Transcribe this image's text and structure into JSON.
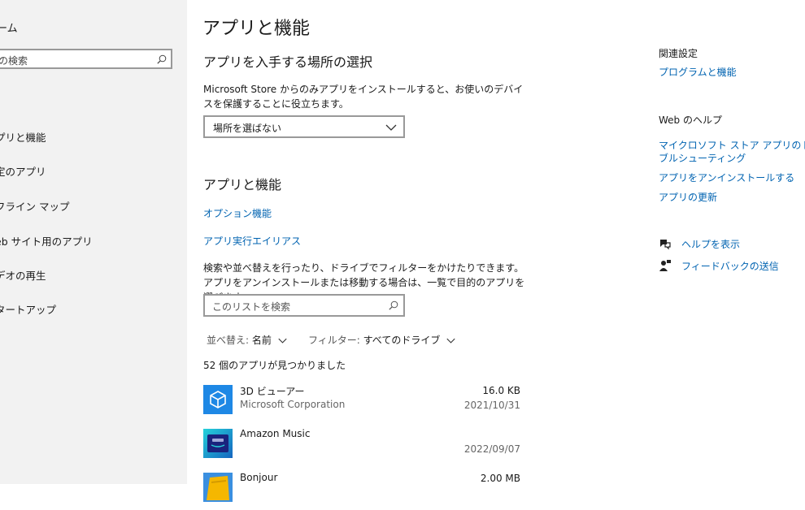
{
  "sidebar": {
    "home_label": "ーム",
    "search_placeholder": "の検索",
    "items": [
      {
        "label": "プリと機能"
      },
      {
        "label": "定のアプリ"
      },
      {
        "label": "フライン マップ"
      },
      {
        "label": "eb サイト用のアプリ"
      },
      {
        "label": "デオの再生"
      },
      {
        "label": "タートアップ"
      }
    ]
  },
  "main": {
    "title": "アプリと機能",
    "choose_section": {
      "title": "アプリを入手する場所の選択",
      "description": "Microsoft Store からのみアプリをインストールすると、お使いのデバイスを保護することに役立ちます。",
      "dropdown_value": "場所を選ばない"
    },
    "apps_section": {
      "title": "アプリと機能",
      "optional_features_link": "オプション機能",
      "aliases_link": "アプリ実行エイリアス",
      "description": "検索や並べ替えを行ったり、ドライブでフィルターをかけたりできます。アプリをアンインストールまたは移動する場合は、一覧で目的のアプリを選びます。",
      "search_placeholder": "このリストを検索",
      "sort_label": "並べ替え:",
      "sort_value": "名前",
      "filter_label": "フィルター:",
      "filter_value": "すべてのドライブ",
      "count_text": "52 個のアプリが見つかりました"
    },
    "apps": [
      {
        "name": "3D ビューアー",
        "publisher": "Microsoft Corporation",
        "size": "16.0 KB",
        "date": "2021/10/31",
        "icon": "3d-viewer-icon",
        "color": "#1e88e5"
      },
      {
        "name": "Amazon Music",
        "publisher": "",
        "size": "",
        "date": "2022/09/07",
        "icon": "amazon-music-icon",
        "color": "#25d1da"
      },
      {
        "name": "Bonjour",
        "publisher": "",
        "size": "2.00 MB",
        "date": "",
        "icon": "bonjour-icon",
        "color": "#f5b700"
      }
    ]
  },
  "right_panel": {
    "related_heading": "関連設定",
    "related_link": "プログラムと機能",
    "web_help_heading": "Web のヘルプ",
    "help_links": [
      {
        "label": "マイクロソフト ストア アプリのトラブルシューティング"
      },
      {
        "label": "アプリをアンインストールする"
      },
      {
        "label": "アプリの更新"
      }
    ],
    "get_help_label": "ヘルプを表示",
    "feedback_label": "フィードバックの送信"
  },
  "colors": {
    "accent": "#0063b1",
    "sidebar_bg": "#f2f2f2"
  }
}
